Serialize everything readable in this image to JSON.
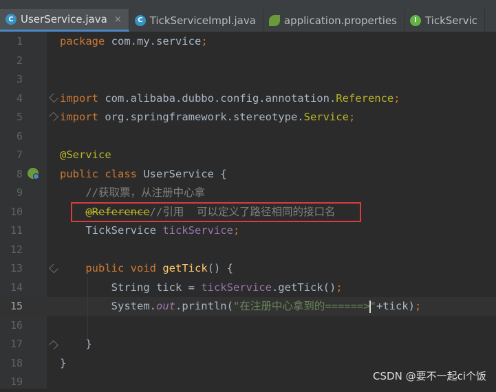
{
  "tabs": [
    {
      "label": "UserService.java",
      "icon": "java-class-icon",
      "active": true
    },
    {
      "label": "TickServiceImpl.java",
      "icon": "java-class-icon",
      "active": false
    },
    {
      "label": "application.properties",
      "icon": "spring-properties-icon",
      "active": false
    },
    {
      "label": "TickServic",
      "icon": "java-interface-icon",
      "active": false
    }
  ],
  "editor": {
    "current_line": 15,
    "lines": [
      {
        "n": "1",
        "segments": [
          [
            "kw",
            "package"
          ],
          [
            "t",
            " com.my.service"
          ],
          [
            "kw",
            ";"
          ]
        ]
      },
      {
        "n": "2",
        "segments": []
      },
      {
        "n": "3",
        "segments": []
      },
      {
        "n": "4",
        "segments": [
          [
            "kw",
            "import"
          ],
          [
            "t",
            " com.alibaba.dubbo.config.annotation."
          ],
          [
            "ann",
            "Reference"
          ],
          [
            "kw",
            ";"
          ]
        ]
      },
      {
        "n": "5",
        "segments": [
          [
            "kw",
            "import"
          ],
          [
            "t",
            " org.springframework.stereotype."
          ],
          [
            "ann",
            "Service"
          ],
          [
            "kw",
            ";"
          ]
        ]
      },
      {
        "n": "6",
        "segments": []
      },
      {
        "n": "7",
        "segments": [
          [
            "ann",
            "@Service"
          ]
        ]
      },
      {
        "n": "8",
        "segments": [
          [
            "kw",
            "public class"
          ],
          [
            "t",
            " UserService {"
          ]
        ]
      },
      {
        "n": "9",
        "segments": [
          [
            "t",
            "    "
          ],
          [
            "cmt",
            "//获取票，从注册中心拿"
          ]
        ]
      },
      {
        "n": "10",
        "segments": [
          [
            "t",
            "    "
          ],
          [
            "ann-strike",
            "@Reference"
          ],
          [
            "cmt",
            "//引用  可以定义了路径相同的接口名"
          ]
        ]
      },
      {
        "n": "11",
        "segments": [
          [
            "t",
            "    TickService "
          ],
          [
            "fld",
            "tickService"
          ],
          [
            "kw",
            ";"
          ]
        ]
      },
      {
        "n": "12",
        "segments": []
      },
      {
        "n": "13",
        "segments": [
          [
            "t",
            "    "
          ],
          [
            "kw",
            "public void"
          ],
          [
            "t",
            " "
          ],
          [
            "fn",
            "getTick"
          ],
          [
            "t",
            "() {"
          ]
        ]
      },
      {
        "n": "14",
        "segments": [
          [
            "t",
            "        String tick = "
          ],
          [
            "fld",
            "tickService"
          ],
          [
            "t",
            ".getTick()"
          ],
          [
            "kw",
            ";"
          ]
        ]
      },
      {
        "n": "15",
        "segments": [
          [
            "t",
            "        System."
          ],
          [
            "ital",
            "out"
          ],
          [
            "t",
            ".println("
          ],
          [
            "str",
            "\"在注册中心拿到的======>"
          ],
          [
            "caret",
            ""
          ],
          [
            "str",
            "\""
          ],
          [
            "t",
            "+tick)"
          ],
          [
            "kw",
            ";"
          ]
        ]
      },
      {
        "n": "16",
        "segments": []
      },
      {
        "n": "17",
        "segments": [
          [
            "t",
            "    }"
          ]
        ]
      },
      {
        "n": "18",
        "segments": [
          [
            "t",
            "}"
          ]
        ]
      },
      {
        "n": "19",
        "segments": []
      }
    ]
  },
  "watermark": "CSDN @要不一起ci个饭",
  "colors": {
    "red_highlight_box": "#e03b3b",
    "active_tab_underline": "#4a88c7"
  }
}
